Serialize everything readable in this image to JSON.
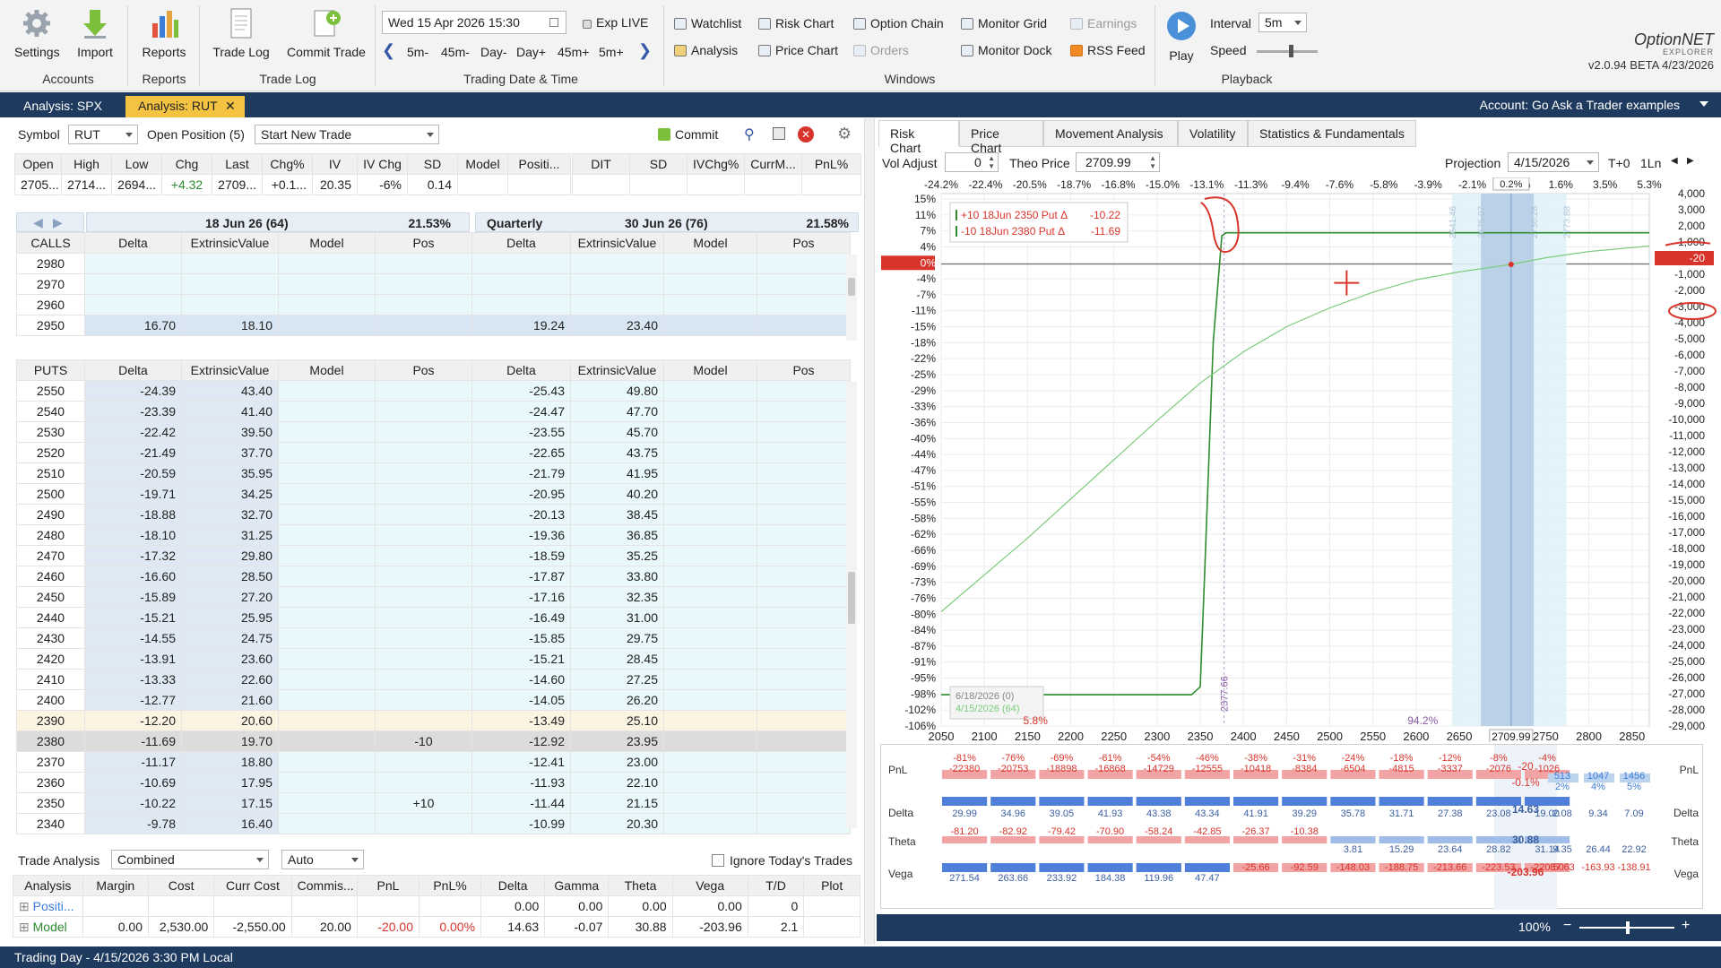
{
  "ribbon": {
    "accounts": {
      "settings": "Settings",
      "import": "Import",
      "group": "Accounts"
    },
    "reports": {
      "reports": "Reports",
      "group": "Reports"
    },
    "tradelog": {
      "trade_log": "Trade Log",
      "commit_trade": "Commit Trade",
      "group": "Trade Log"
    },
    "datetime": {
      "value": "Wed 15 Apr 2026 15:30",
      "exp_live": "Exp LIVE",
      "steps": [
        "5m-",
        "45m-",
        "Day-",
        "Day+",
        "45m+",
        "5m+"
      ],
      "group": "Trading Date & Time"
    },
    "windows": {
      "watchlist": "Watchlist",
      "risk_chart": "Risk Chart",
      "option_chain": "Option Chain",
      "monitor_grid": "Monitor Grid",
      "earnings": "Earnings",
      "analysis": "Analysis",
      "price_chart": "Price Chart",
      "orders": "Orders",
      "monitor_dock": "Monitor Dock",
      "rss_feed": "RSS Feed",
      "group": "Windows"
    },
    "playback": {
      "play": "Play",
      "interval_label": "Interval",
      "interval_value": "5m",
      "speed_label": "Speed",
      "group": "Playback"
    },
    "brand": {
      "name": "OptionNET",
      "sub": "EXPLORER",
      "version": "v2.0.94 BETA 4/23/2026"
    }
  },
  "tabs": [
    {
      "label": "Analysis: SPX"
    },
    {
      "label": "Analysis: RUT"
    }
  ],
  "account": "Account: Go Ask a Trader examples",
  "toolbar": {
    "symbol_label": "Symbol",
    "symbol": "RUT",
    "open_position": "Open Position (5)",
    "trade_select": "Start New Trade",
    "commit": "Commit"
  },
  "quote": {
    "headers": [
      "Open",
      "High",
      "Low",
      "Chg",
      "Last",
      "Chg%",
      "IV",
      "IV Chg",
      "SD",
      "Model",
      "Positi..."
    ],
    "values": [
      "2705...",
      "2714...",
      "2694...",
      "+4.32",
      "2709...",
      "+0.1...",
      "20.35",
      "-6%",
      "0.14",
      "",
      ""
    ],
    "headers2": [
      "DIT",
      "SD",
      "IVChg%",
      "CurrM...",
      "PnL%"
    ]
  },
  "expiries": [
    {
      "title": "18 Jun 26 (64)",
      "iv": "21.53%"
    },
    {
      "prefix": "Quarterly",
      "title": "30 Jun 26 (76)",
      "iv": "21.58%"
    }
  ],
  "chain_cols": [
    "Delta",
    "ExtrinsicValue",
    "Model",
    "Pos"
  ],
  "calls": {
    "label": "CALLS",
    "rows": [
      {
        "strike": "2980",
        "a": [
          "",
          "",
          "",
          ""
        ],
        "b": [
          "",
          "",
          "",
          ""
        ]
      },
      {
        "strike": "2970",
        "a": [
          "",
          "",
          "",
          ""
        ],
        "b": [
          "",
          "",
          "",
          ""
        ]
      },
      {
        "strike": "2960",
        "a": [
          "",
          "",
          "",
          ""
        ],
        "b": [
          "",
          "",
          "",
          ""
        ]
      },
      {
        "strike": "2950",
        "a": [
          "16.70",
          "18.10",
          "",
          ""
        ],
        "b": [
          "19.24",
          "23.40",
          "",
          ""
        ]
      }
    ]
  },
  "puts": {
    "label": "PUTS",
    "rows": [
      {
        "strike": "2550",
        "a": [
          "-24.39",
          "43.40",
          "",
          ""
        ],
        "b": [
          "-25.43",
          "49.80",
          "",
          ""
        ]
      },
      {
        "strike": "2540",
        "a": [
          "-23.39",
          "41.40",
          "",
          ""
        ],
        "b": [
          "-24.47",
          "47.70",
          "",
          ""
        ]
      },
      {
        "strike": "2530",
        "a": [
          "-22.42",
          "39.50",
          "",
          ""
        ],
        "b": [
          "-23.55",
          "45.70",
          "",
          ""
        ]
      },
      {
        "strike": "2520",
        "a": [
          "-21.49",
          "37.70",
          "",
          ""
        ],
        "b": [
          "-22.65",
          "43.75",
          "",
          ""
        ]
      },
      {
        "strike": "2510",
        "a": [
          "-20.59",
          "35.95",
          "",
          ""
        ],
        "b": [
          "-21.79",
          "41.95",
          "",
          ""
        ]
      },
      {
        "strike": "2500",
        "a": [
          "-19.71",
          "34.25",
          "",
          ""
        ],
        "b": [
          "-20.95",
          "40.20",
          "",
          ""
        ]
      },
      {
        "strike": "2490",
        "a": [
          "-18.88",
          "32.70",
          "",
          ""
        ],
        "b": [
          "-20.13",
          "38.45",
          "",
          ""
        ]
      },
      {
        "strike": "2480",
        "a": [
          "-18.10",
          "31.25",
          "",
          ""
        ],
        "b": [
          "-19.36",
          "36.85",
          "",
          ""
        ]
      },
      {
        "strike": "2470",
        "a": [
          "-17.32",
          "29.80",
          "",
          ""
        ],
        "b": [
          "-18.59",
          "35.25",
          "",
          ""
        ]
      },
      {
        "strike": "2460",
        "a": [
          "-16.60",
          "28.50",
          "",
          ""
        ],
        "b": [
          "-17.87",
          "33.80",
          "",
          ""
        ]
      },
      {
        "strike": "2450",
        "a": [
          "-15.89",
          "27.20",
          "",
          ""
        ],
        "b": [
          "-17.16",
          "32.35",
          "",
          ""
        ]
      },
      {
        "strike": "2440",
        "a": [
          "-15.21",
          "25.95",
          "",
          ""
        ],
        "b": [
          "-16.49",
          "31.00",
          "",
          ""
        ]
      },
      {
        "strike": "2430",
        "a": [
          "-14.55",
          "24.75",
          "",
          ""
        ],
        "b": [
          "-15.85",
          "29.75",
          "",
          ""
        ]
      },
      {
        "strike": "2420",
        "a": [
          "-13.91",
          "23.60",
          "",
          ""
        ],
        "b": [
          "-15.21",
          "28.45",
          "",
          ""
        ]
      },
      {
        "strike": "2410",
        "a": [
          "-13.33",
          "22.60",
          "",
          ""
        ],
        "b": [
          "-14.60",
          "27.25",
          "",
          ""
        ]
      },
      {
        "strike": "2400",
        "a": [
          "-12.77",
          "21.60",
          "",
          ""
        ],
        "b": [
          "-14.05",
          "26.20",
          "",
          ""
        ]
      },
      {
        "strike": "2390",
        "a": [
          "-12.20",
          "20.60",
          "",
          ""
        ],
        "b": [
          "-13.49",
          "25.10",
          "",
          ""
        ]
      },
      {
        "strike": "2380",
        "a": [
          "-11.69",
          "19.70",
          "",
          "-10"
        ],
        "b": [
          "-12.92",
          "23.95",
          "",
          ""
        ]
      },
      {
        "strike": "2370",
        "a": [
          "-11.17",
          "18.80",
          "",
          ""
        ],
        "b": [
          "-12.41",
          "23.00",
          "",
          ""
        ]
      },
      {
        "strike": "2360",
        "a": [
          "-10.69",
          "17.95",
          "",
          ""
        ],
        "b": [
          "-11.93",
          "22.10",
          "",
          ""
        ]
      },
      {
        "strike": "2350",
        "a": [
          "-10.22",
          "17.15",
          "",
          "+10"
        ],
        "b": [
          "-11.44",
          "21.15",
          "",
          ""
        ]
      },
      {
        "strike": "2340",
        "a": [
          "-9.78",
          "16.40",
          "",
          ""
        ],
        "b": [
          "-10.99",
          "20.30",
          "",
          ""
        ]
      }
    ]
  },
  "trade_analysis": {
    "label": "Trade Analysis",
    "mode": "Combined",
    "auto": "Auto",
    "ignore_label": "Ignore Today's Trades",
    "headers": [
      "Analysis",
      "Margin",
      "Cost",
      "Curr Cost",
      "Commis...",
      "PnL",
      "PnL%",
      "Delta",
      "Gamma",
      "Theta",
      "Vega",
      "T/D",
      "Plot"
    ],
    "rows": [
      {
        "name": "Positi...",
        "vals": [
          "",
          "",
          "",
          "",
          "",
          "",
          "0.00",
          "0.00",
          "0.00",
          "0.00",
          "0",
          ""
        ]
      },
      {
        "name": "Model",
        "vals": [
          "0.00",
          "2,530.00",
          "-2,550.00",
          "20.00",
          "-20.00",
          "0.00%",
          "14.63",
          "-0.07",
          "30.88",
          "-203.96",
          "2.1",
          ""
        ]
      }
    ]
  },
  "right_tabs": [
    "Risk Chart",
    "Price Chart",
    "Movement Analysis",
    "Volatility",
    "Statistics & Fundamentals"
  ],
  "risk_controls": {
    "vol_adjust_label": "Vol Adjust",
    "vol_adjust": "0",
    "theo_label": "Theo Price",
    "theo": "2709.99",
    "projection_label": "Projection",
    "projection": "4/15/2026",
    "t0": "T+0",
    "ln": "1Ln"
  },
  "chart_data": {
    "type": "line",
    "x_ticks": [
      "2050",
      "2100",
      "2150",
      "2200",
      "2250",
      "2300",
      "2350",
      "2400",
      "2450",
      "2500",
      "2550",
      "2600",
      "2650",
      "2700",
      "2750",
      "2800",
      "2850"
    ],
    "xlim": [
      2050,
      2870
    ],
    "top_pct_ticks": [
      "-24.2%",
      "-22.4%",
      "-20.5%",
      "-18.7%",
      "-16.8%",
      "-15.0%",
      "-13.1%",
      "-11.3%",
      "-9.4%",
      "-7.6%",
      "-5.8%",
      "-3.9%",
      "-2.1%",
      "-0.2%",
      "1.6%",
      "3.5%",
      "5.3%"
    ],
    "left_pct_ticks": [
      "15%",
      "11%",
      "7%",
      "4%",
      "0%",
      "-4%",
      "-7%",
      "-11%",
      "-15%",
      "-18%",
      "-22%",
      "-25%",
      "-29%",
      "-33%",
      "-36%",
      "-40%",
      "-44%",
      "-47%",
      "-51%",
      "-55%",
      "-58%",
      "-62%",
      "-66%",
      "-69%",
      "-73%",
      "-76%",
      "-80%",
      "-84%",
      "-87%",
      "-91%",
      "-95%",
      "-98%",
      "-102%",
      "-106%"
    ],
    "right_ticks": [
      "4,000",
      "3,000",
      "2,000",
      "1,000",
      "-20",
      "-1,000",
      "-2,000",
      "-3,000",
      "-4,000",
      "-5,000",
      "-6,000",
      "-7,000",
      "-8,000",
      "-9,000",
      "-10,000",
      "-11,000",
      "-12,000",
      "-13,000",
      "-14,000",
      "-15,000",
      "-16,000",
      "-17,000",
      "-18,000",
      "-19,000",
      "-20,000",
      "-21,000",
      "-22,000",
      "-23,000",
      "-24,000",
      "-25,000",
      "-26,000",
      "-27,000",
      "-28,000",
      "-29,000"
    ],
    "ylim": [
      -29500,
      4500
    ],
    "series": [
      {
        "name": "6/18/2026 (0)",
        "color": "#2e8b2e",
        "points": [
          [
            2050,
            -27500
          ],
          [
            2340,
            -27500
          ],
          [
            2350,
            -27000
          ],
          [
            2355,
            -20000
          ],
          [
            2365,
            -5000
          ],
          [
            2375,
            1800
          ],
          [
            2380,
            2000
          ],
          [
            2870,
            2000
          ]
        ]
      },
      {
        "name": "4/15/2026 (64)",
        "color": "#7ccc7c",
        "points": [
          [
            2050,
            -22200
          ],
          [
            2150,
            -17500
          ],
          [
            2250,
            -12500
          ],
          [
            2300,
            -10000
          ],
          [
            2350,
            -7600
          ],
          [
            2400,
            -5600
          ],
          [
            2450,
            -4000
          ],
          [
            2500,
            -2800
          ],
          [
            2550,
            -1800
          ],
          [
            2600,
            -1000
          ],
          [
            2650,
            -500
          ],
          [
            2709.99,
            -20
          ],
          [
            2750,
            400
          ],
          [
            2800,
            800
          ],
          [
            2870,
            1150
          ]
        ]
      }
    ],
    "legend": [
      {
        "label": "+10 18Jun 2350 Put Δ",
        "value": "-10.22"
      },
      {
        "label": "-10 18Jun 2380 Put Δ",
        "value": "-11.69"
      }
    ],
    "bottom_left": "5.8%",
    "bottom_right": "94.2%",
    "zero_label": "0%",
    "right_zero": "-20",
    "current_x": "2709.99",
    "top_zero": "0.2%",
    "strike_marker": "2377.66",
    "sd_labels": [
      "2641.46",
      "2675.07",
      "2736.28",
      "2773.88"
    ]
  },
  "greeks_table": {
    "labels": [
      "PnL",
      "Delta",
      "Theta",
      "Vega"
    ],
    "pnl_pct": [
      "-81%",
      "-76%",
      "-69%",
      "-61%",
      "-54%",
      "-46%",
      "-38%",
      "-31%",
      "-24%",
      "-18%",
      "-12%",
      "-8%",
      "-4%"
    ],
    "pnl": [
      "-22380",
      "-20753",
      "-18898",
      "-16868",
      "-14729",
      "-12555",
      "-10418",
      "-8384",
      "-6504",
      "-4815",
      "-3337",
      "-2076",
      "-1026"
    ],
    "pnl_cur": "-20",
    "pnl_cur_pct": "-0.1%",
    "pnl_right": [
      "513",
      "1047",
      "1456"
    ],
    "pnl_right_pct": [
      "2%",
      "4%",
      "5%"
    ],
    "delta": [
      "29.99",
      "34.96",
      "39.05",
      "41.93",
      "43.38",
      "43.34",
      "41.91",
      "39.29",
      "35.78",
      "31.71",
      "27.38",
      "23.08",
      "19.00"
    ],
    "delta_cur": "14.63",
    "delta_right": [
      "2.08",
      "9.34",
      "7.09"
    ],
    "theta": [
      "-81.20",
      "-82.92",
      "-79.42",
      "-70.90",
      "-58.24",
      "-42.85",
      "-26.37",
      "-10.38",
      "3.81",
      "15.29",
      "23.64",
      "28.82",
      "31.14"
    ],
    "theta_cur": "30.88",
    "theta_right": [
      "9.35",
      "26.44",
      "22.92"
    ],
    "vega": [
      "271.54",
      "263.66",
      "233.92",
      "184.38",
      "119.96",
      "47.47",
      "-25.66",
      "-92.59",
      "-148.03",
      "-188.75",
      "-213.66",
      "-223.53",
      "-220.50"
    ],
    "vega_cur": "-203.96",
    "vega_right": [
      "87.63",
      "-163.93",
      "-138.91"
    ]
  },
  "zoom": "100%",
  "status": "Trading Day - 4/15/2026 3:30 PM Local"
}
